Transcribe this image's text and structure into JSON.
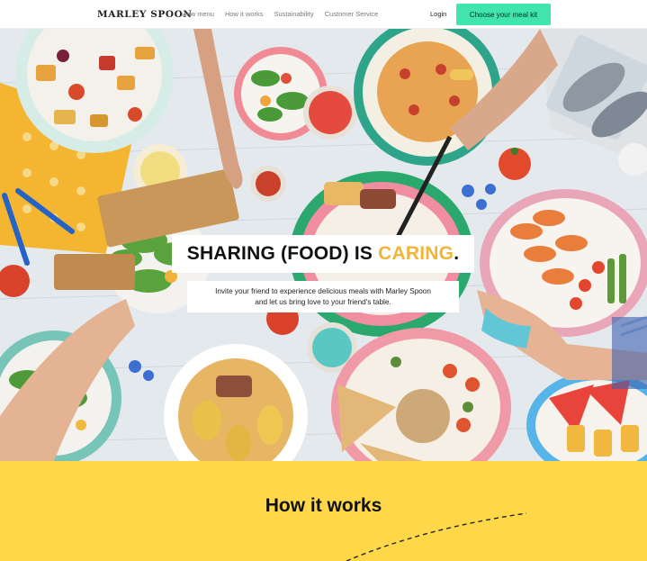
{
  "header": {
    "logo_main": "MARLEY",
    "logo_y": "",
    "logo_rest": " SPOON",
    "nav": [
      "View menu",
      "How it works",
      "Sustainability",
      "Customer Service"
    ],
    "login": "Login",
    "cta": "Choose your meal kit"
  },
  "hero": {
    "headline_part1": "SHARING (FOOD) IS ",
    "headline_accent": "CARING",
    "headline_end": ".",
    "subtext_line1": "Invite your friend to experience delicious meals with Marley Spoon",
    "subtext_line2": "and let us bring love to your friend's table."
  },
  "how_it_works": {
    "title": "How it works"
  },
  "colors": {
    "cta": "#3fe5ad",
    "accent": "#f2b53a",
    "section_bg": "#ffd84a"
  }
}
